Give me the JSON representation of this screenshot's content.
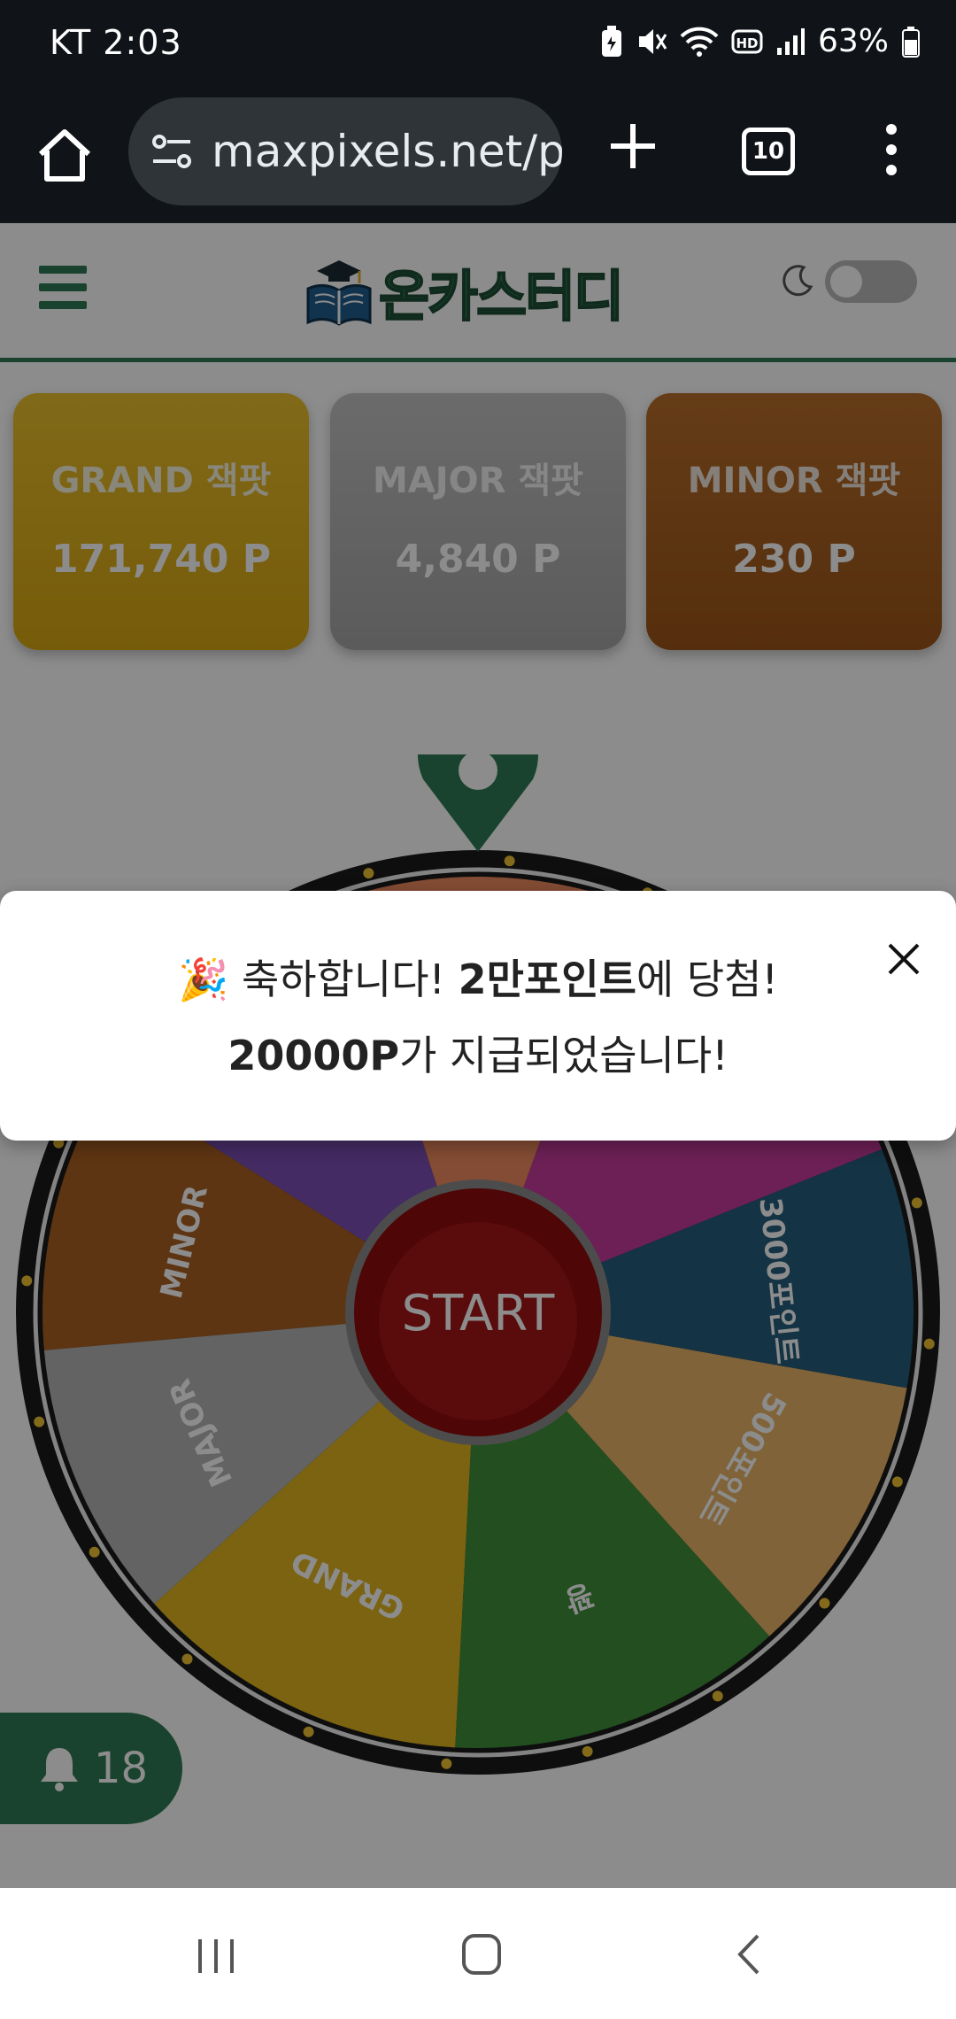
{
  "status_bar": {
    "carrier": "KT",
    "time": "2:03",
    "battery": "63%",
    "icons": [
      "battery-saver-icon",
      "mute-icon",
      "wifi-icon",
      "hd-icon",
      "signal-icon",
      "battery-icon"
    ]
  },
  "browser": {
    "url": "maxpixels.net/p",
    "tab_count": "10",
    "icons": [
      "home-icon",
      "site-settings-icon",
      "new-tab-icon",
      "more-menu-icon"
    ]
  },
  "site": {
    "logo_text": "온카스터디",
    "brand_color": "#2e7a55"
  },
  "jackpots": [
    {
      "label": "GRAND 잭팟",
      "value": "171,740 P",
      "color": "#e0b421"
    },
    {
      "label": "MAJOR 잭팟",
      "value": "4,840 P",
      "color": "#b4b4b4"
    },
    {
      "label": "MINOR 잭팟",
      "value": "230 P",
      "color": "#ab6121"
    }
  ],
  "wheel": {
    "start_label": "START",
    "segments": [
      {
        "label": "MINOR",
        "color": "#ab6121"
      },
      {
        "label": "MAJOR",
        "color": "#b4b4b4"
      },
      {
        "label": "GRAND",
        "color": "#e0b421"
      },
      {
        "label": "꽝",
        "color": "#3f8f3b"
      },
      {
        "label": "500포인트",
        "color": "#e9b567"
      },
      {
        "label": "3000포인트",
        "color": "#255e7c"
      }
    ]
  },
  "notification": {
    "count": "18"
  },
  "toast": {
    "emoji": "🎉",
    "line1_pre": "축하합니다! ",
    "line1_bold": "2만포인트",
    "line1_post": "에 당첨!",
    "line2_bold": "20000P",
    "line2_post": "가 지급되었습니다!"
  }
}
